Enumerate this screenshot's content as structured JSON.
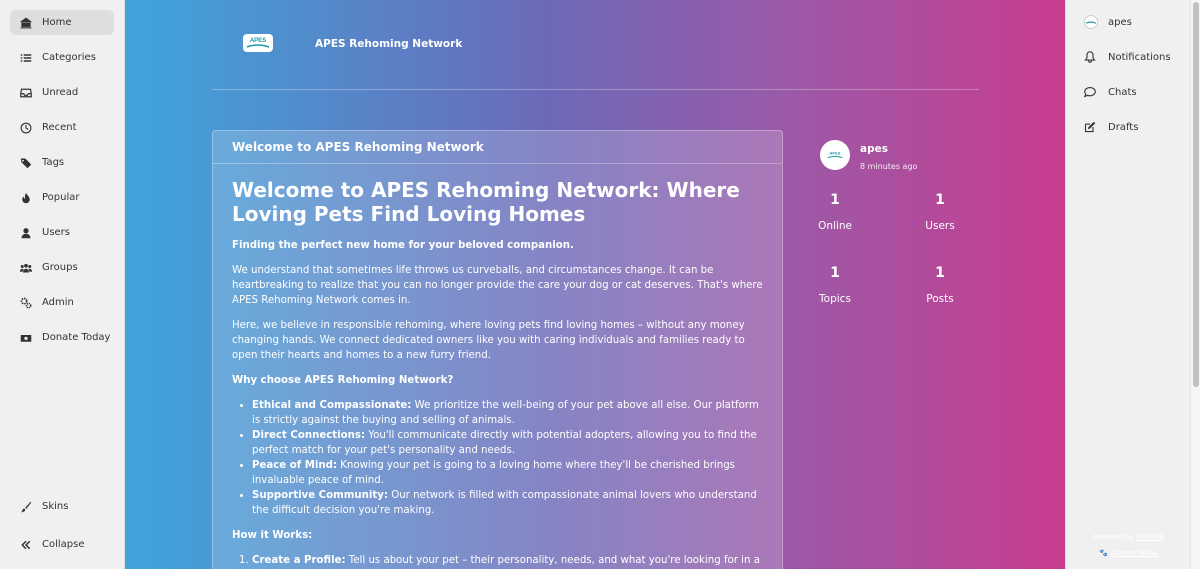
{
  "left_nav": {
    "items": [
      {
        "label": "Home",
        "icon": "home-icon"
      },
      {
        "label": "Categories",
        "icon": "list-icon"
      },
      {
        "label": "Unread",
        "icon": "inbox-icon"
      },
      {
        "label": "Recent",
        "icon": "clock-icon"
      },
      {
        "label": "Tags",
        "icon": "tags-icon"
      },
      {
        "label": "Popular",
        "icon": "fire-icon"
      },
      {
        "label": "Users",
        "icon": "user-icon"
      },
      {
        "label": "Groups",
        "icon": "users-icon"
      },
      {
        "label": "Admin",
        "icon": "gears-icon"
      },
      {
        "label": "Donate Today",
        "icon": "money-icon"
      }
    ],
    "skins_label": "Skins",
    "collapse_label": "Collapse"
  },
  "brand": {
    "logo_text": "APES",
    "name": "APES Rehoming Network"
  },
  "topic": {
    "header": "Welcome to APES Rehoming Network",
    "title": "Welcome to APES Rehoming Network: Where Loving Pets Find Loving Homes",
    "subtitle": "Finding the perfect new home for your beloved companion.",
    "para1": "We understand that sometimes life throws us curveballs, and circumstances change. It can be heartbreaking to realize that you can no longer provide the care your dog or cat deserves. That's where APES Rehoming Network comes in.",
    "para2": "Here, we believe in responsible rehoming, where loving pets find loving homes – without any money changing hands. We connect dedicated owners like you with caring individuals and families ready to open their hearts and homes to a new furry friend.",
    "why_heading": "Why choose APES Rehoming Network?",
    "why_items": [
      {
        "bold": "Ethical and Compassionate:",
        "text": " We prioritize the well-being of your pet above all else. Our platform is strictly against the buying and selling of animals."
      },
      {
        "bold": "Direct Connections:",
        "text": " You'll communicate directly with potential adopters, allowing you to find the perfect match for your pet's personality and needs."
      },
      {
        "bold": "Peace of Mind:",
        "text": " Knowing your pet is going to a loving home where they'll be cherished brings invaluable peace of mind."
      },
      {
        "bold": "Supportive Community:",
        "text": " Our network is filled with compassionate animal lovers who understand the difficult decision you're making."
      }
    ],
    "how_heading": "How it Works:",
    "how_items": [
      {
        "bold": "Create a Profile:",
        "text": " Tell us about your pet – their personality, needs, and what you're looking for in a new"
      }
    ]
  },
  "author": {
    "name": "apes",
    "time": "8 minutes ago"
  },
  "stats": {
    "online": {
      "value": "1",
      "label": "Online"
    },
    "users": {
      "value": "1",
      "label": "Users"
    },
    "topics": {
      "value": "1",
      "label": "Topics"
    },
    "posts": {
      "value": "1",
      "label": "Posts"
    }
  },
  "right_nav": {
    "username": "apes",
    "notifications": "Notifications",
    "chats": "Chats",
    "drafts": "Drafts"
  },
  "footer": {
    "powered_prefix": "Powered by ",
    "powered_link": "NodeBB",
    "donate_link": "Donate Today"
  }
}
